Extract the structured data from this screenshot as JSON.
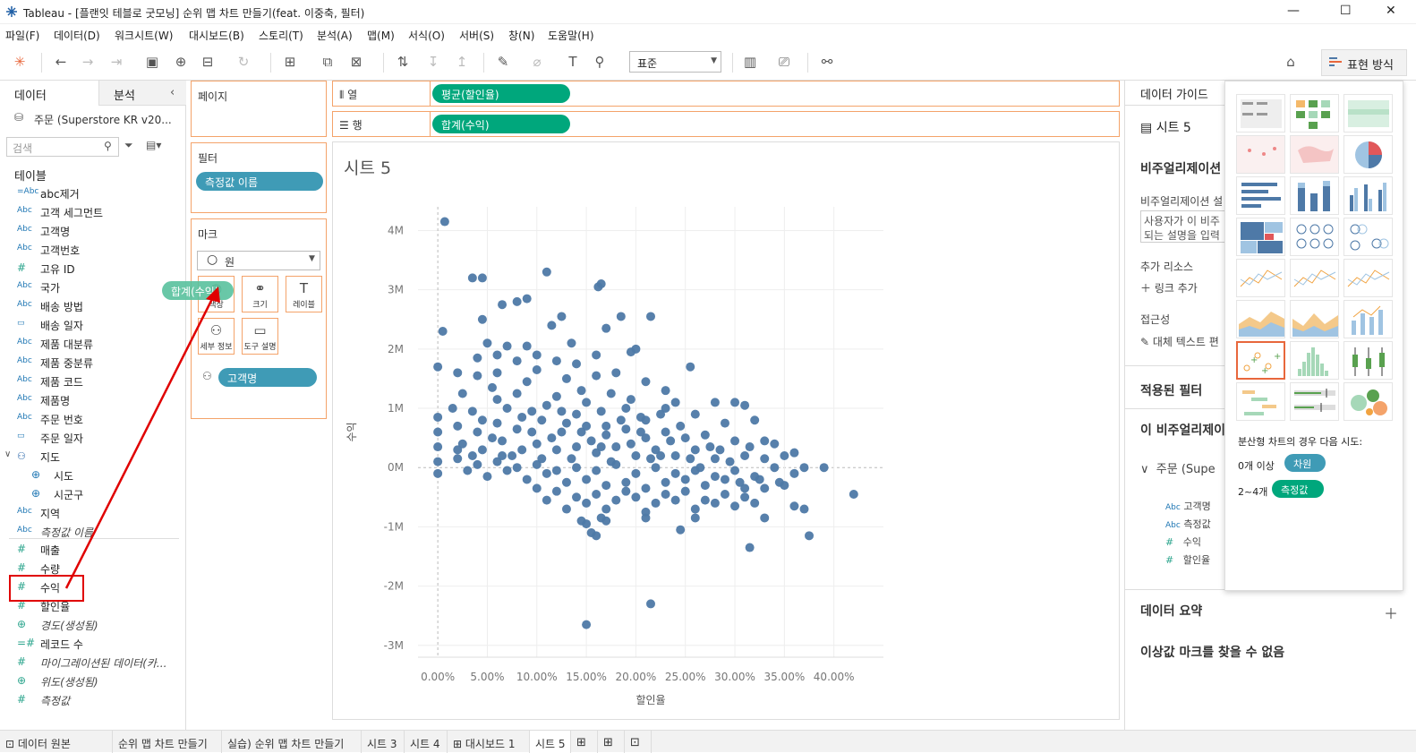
{
  "window": {
    "title": "Tableau - [플랜잇 테블로 굿모닝] 순위 맵 차트 만들기(feat. 이중축, 필터)",
    "min": "—",
    "max": "☐",
    "close": "✕"
  },
  "menu": [
    "파일(F)",
    "데이터(D)",
    "워크시트(W)",
    "대시보드(B)",
    "스토리(T)",
    "분석(A)",
    "맵(M)",
    "서식(O)",
    "서버(S)",
    "창(N)",
    "도움말(H)"
  ],
  "toolbar": {
    "fit_select": "표준",
    "show_me_label": "표현 방식"
  },
  "left_panel": {
    "tab_data": "데이터",
    "tab_analysis": "분석",
    "datasource": "주문 (Superstore KR v20...",
    "search_placeholder": "검색",
    "tables_header": "테이블",
    "fields": [
      {
        "type": "=Abc",
        "label": "abc제거",
        "italic": false
      },
      {
        "type": "Abc",
        "label": "고객 세그먼트",
        "italic": false
      },
      {
        "type": "Abc",
        "label": "고객명",
        "italic": false
      },
      {
        "type": "Abc",
        "label": "고객번호",
        "italic": false
      },
      {
        "type": "#",
        "label": "고유 ID",
        "italic": false
      },
      {
        "type": "Abc",
        "label": "국가",
        "italic": false
      },
      {
        "type": "Abc",
        "label": "배송 방법",
        "italic": false
      },
      {
        "type": "cal",
        "label": "배송 일자",
        "italic": false
      },
      {
        "type": "Abc",
        "label": "제품 대분류",
        "italic": false
      },
      {
        "type": "Abc",
        "label": "제품 중분류",
        "italic": false
      },
      {
        "type": "Abc",
        "label": "제품 코드",
        "italic": false
      },
      {
        "type": "Abc",
        "label": "제품명",
        "italic": false
      },
      {
        "type": "Abc",
        "label": "주문 번호",
        "italic": false
      },
      {
        "type": "cal",
        "label": "주문 일자",
        "italic": false
      },
      {
        "type": "hier",
        "label": "지도",
        "italic": false
      },
      {
        "type": "globe",
        "label": "시도",
        "italic": false,
        "indent": true
      },
      {
        "type": "globe",
        "label": "시군구",
        "italic": false,
        "indent": true
      },
      {
        "type": "Abc",
        "label": "지역",
        "italic": false
      },
      {
        "type": "Abc",
        "label": "측정값 이름",
        "italic": true
      }
    ],
    "measures": [
      {
        "type": "#",
        "label": "매출",
        "italic": false
      },
      {
        "type": "#",
        "label": "수량",
        "italic": false
      },
      {
        "type": "#",
        "label": "수익",
        "italic": false
      },
      {
        "type": "#",
        "label": "할인율",
        "italic": false
      },
      {
        "type": "globe",
        "label": "경도(생성됨)",
        "italic": true
      },
      {
        "type": "=#",
        "label": "레코드 수",
        "italic": false
      },
      {
        "type": "#",
        "label": "마이그레이션된 데이터(카...",
        "italic": true
      },
      {
        "type": "globe",
        "label": "위도(생성됨)",
        "italic": true
      },
      {
        "type": "#",
        "label": "측정값",
        "italic": true
      }
    ]
  },
  "mid_panel": {
    "pages": "페이지",
    "filters": "필터",
    "filter_pill": "측정값 이름",
    "marks": "마크",
    "mark_type": "원",
    "mark_buttons": [
      "색상",
      "크기",
      "레이블",
      "세부 정보",
      "도구 설명"
    ],
    "detail_pill": "고객명",
    "drag_pill": "합계(수익)"
  },
  "shelves": {
    "columns_label": "열",
    "columns_pill": "평균(할인율)",
    "rows_label": "행",
    "rows_pill": "합계(수익)"
  },
  "sheet_title": "시트 5",
  "chart_data": {
    "type": "scatter",
    "xlabel": "할인율",
    "ylabel": "수익",
    "xlim": [
      -0.02,
      0.45
    ],
    "ylim": [
      -3.2,
      4.4
    ],
    "x_ticks": [
      "0.00%",
      "5.00%",
      "10.00%",
      "15.00%",
      "20.00%",
      "25.00%",
      "30.00%",
      "35.00%",
      "40.00%"
    ],
    "y_ticks": [
      "4M",
      "3M",
      "2M",
      "1M",
      "0M",
      "-1M",
      "-2M",
      "-3M"
    ],
    "color": "#4e79a7",
    "points_note": "approx 800 customers",
    "points": [
      [
        0.007,
        4.15
      ],
      [
        0.035,
        3.2
      ],
      [
        0.045,
        3.2
      ],
      [
        0.11,
        3.3
      ],
      [
        0.165,
        3.1
      ],
      [
        0.162,
        3.05
      ],
      [
        0.09,
        2.85
      ],
      [
        0.08,
        2.8
      ],
      [
        0.065,
        2.75
      ],
      [
        0.125,
        2.55
      ],
      [
        0.215,
        2.55
      ],
      [
        0.185,
        2.55
      ],
      [
        0.17,
        2.35
      ],
      [
        0.115,
        2.4
      ],
      [
        0.045,
        2.5
      ],
      [
        0.005,
        2.3
      ],
      [
        0.05,
        2.1
      ],
      [
        0.07,
        2.05
      ],
      [
        0.09,
        2.05
      ],
      [
        0.135,
        2.1
      ],
      [
        0.2,
        2.0
      ],
      [
        0.195,
        1.95
      ],
      [
        0.255,
        1.7
      ],
      [
        0.0,
        1.7
      ],
      [
        0.02,
        1.6
      ],
      [
        0.04,
        1.55
      ],
      [
        0.06,
        1.6
      ],
      [
        0.1,
        1.65
      ],
      [
        0.13,
        1.5
      ],
      [
        0.16,
        1.55
      ],
      [
        0.21,
        1.45
      ],
      [
        0.23,
        1.3
      ],
      [
        0.025,
        1.25
      ],
      [
        0.055,
        1.35
      ],
      [
        0.08,
        1.25
      ],
      [
        0.12,
        1.2
      ],
      [
        0.145,
        1.3
      ],
      [
        0.175,
        1.25
      ],
      [
        0.195,
        1.15
      ],
      [
        0.24,
        1.1
      ],
      [
        0.28,
        1.1
      ],
      [
        0.3,
        1.1
      ],
      [
        0.31,
        1.05
      ],
      [
        0.0,
        0.85
      ],
      [
        0.015,
        1.0
      ],
      [
        0.035,
        0.95
      ],
      [
        0.07,
        1.0
      ],
      [
        0.095,
        0.95
      ],
      [
        0.14,
        0.9
      ],
      [
        0.165,
        0.95
      ],
      [
        0.205,
        0.85
      ],
      [
        0.225,
        0.9
      ],
      [
        0.26,
        0.9
      ],
      [
        0.29,
        0.75
      ],
      [
        0.32,
        0.8
      ],
      [
        0.0,
        0.6
      ],
      [
        0.02,
        0.7
      ],
      [
        0.04,
        0.6
      ],
      [
        0.06,
        0.75
      ],
      [
        0.08,
        0.65
      ],
      [
        0.105,
        0.8
      ],
      [
        0.125,
        0.6
      ],
      [
        0.15,
        0.7
      ],
      [
        0.17,
        0.55
      ],
      [
        0.19,
        0.65
      ],
      [
        0.21,
        0.5
      ],
      [
        0.23,
        0.6
      ],
      [
        0.25,
        0.5
      ],
      [
        0.27,
        0.55
      ],
      [
        0.3,
        0.45
      ],
      [
        0.33,
        0.45
      ],
      [
        0.34,
        0.4
      ],
      [
        0.0,
        0.35
      ],
      [
        0.025,
        0.4
      ],
      [
        0.045,
        0.3
      ],
      [
        0.065,
        0.45
      ],
      [
        0.085,
        0.3
      ],
      [
        0.1,
        0.4
      ],
      [
        0.12,
        0.3
      ],
      [
        0.14,
        0.35
      ],
      [
        0.16,
        0.25
      ],
      [
        0.18,
        0.35
      ],
      [
        0.2,
        0.2
      ],
      [
        0.22,
        0.3
      ],
      [
        0.24,
        0.2
      ],
      [
        0.26,
        0.3
      ],
      [
        0.28,
        0.15
      ],
      [
        0.31,
        0.2
      ],
      [
        0.33,
        0.15
      ],
      [
        0.35,
        0.2
      ],
      [
        0.36,
        0.25
      ],
      [
        0.0,
        0.1
      ],
      [
        0.02,
        0.15
      ],
      [
        0.04,
        0.05
      ],
      [
        0.06,
        0.1
      ],
      [
        0.08,
        0.0
      ],
      [
        0.1,
        0.05
      ],
      [
        0.12,
        -0.05
      ],
      [
        0.14,
        0.0
      ],
      [
        0.16,
        -0.05
      ],
      [
        0.18,
        0.05
      ],
      [
        0.2,
        -0.1
      ],
      [
        0.22,
        0.0
      ],
      [
        0.24,
        -0.1
      ],
      [
        0.26,
        -0.05
      ],
      [
        0.28,
        -0.15
      ],
      [
        0.3,
        -0.05
      ],
      [
        0.32,
        -0.15
      ],
      [
        0.34,
        0.0
      ],
      [
        0.36,
        -0.1
      ],
      [
        0.37,
        0.0
      ],
      [
        0.39,
        0.0
      ],
      [
        0.42,
        -0.45
      ],
      [
        0.0,
        -0.1
      ],
      [
        0.03,
        -0.05
      ],
      [
        0.05,
        -0.15
      ],
      [
        0.07,
        -0.05
      ],
      [
        0.09,
        -0.2
      ],
      [
        0.11,
        -0.1
      ],
      [
        0.13,
        -0.25
      ],
      [
        0.15,
        -0.2
      ],
      [
        0.17,
        -0.3
      ],
      [
        0.19,
        -0.25
      ],
      [
        0.21,
        -0.35
      ],
      [
        0.23,
        -0.25
      ],
      [
        0.25,
        -0.4
      ],
      [
        0.27,
        -0.3
      ],
      [
        0.29,
        -0.45
      ],
      [
        0.31,
        -0.35
      ],
      [
        0.35,
        -0.3
      ],
      [
        0.36,
        -0.65
      ],
      [
        0.37,
        -0.7
      ],
      [
        0.1,
        -0.35
      ],
      [
        0.12,
        -0.4
      ],
      [
        0.14,
        -0.5
      ],
      [
        0.16,
        -0.45
      ],
      [
        0.18,
        -0.55
      ],
      [
        0.2,
        -0.5
      ],
      [
        0.22,
        -0.6
      ],
      [
        0.24,
        -0.55
      ],
      [
        0.26,
        -0.7
      ],
      [
        0.28,
        -0.6
      ],
      [
        0.3,
        -0.65
      ],
      [
        0.32,
        -0.6
      ],
      [
        0.33,
        -0.85
      ],
      [
        0.145,
        -0.9
      ],
      [
        0.15,
        -0.95
      ],
      [
        0.165,
        -0.85
      ],
      [
        0.17,
        -0.9
      ],
      [
        0.21,
        -0.85
      ],
      [
        0.245,
        -1.05
      ],
      [
        0.26,
        -0.85
      ],
      [
        0.155,
        -1.1
      ],
      [
        0.16,
        -1.15
      ],
      [
        0.375,
        -1.15
      ],
      [
        0.315,
        -1.35
      ],
      [
        0.215,
        -2.3
      ],
      [
        0.15,
        -2.65
      ],
      [
        0.02,
        0.3
      ],
      [
        0.035,
        0.2
      ],
      [
        0.055,
        0.5
      ],
      [
        0.075,
        0.2
      ],
      [
        0.095,
        0.6
      ],
      [
        0.115,
        0.5
      ],
      [
        0.135,
        0.15
      ],
      [
        0.155,
        0.45
      ],
      [
        0.175,
        0.1
      ],
      [
        0.195,
        0.4
      ],
      [
        0.215,
        0.15
      ],
      [
        0.235,
        0.45
      ],
      [
        0.255,
        0.15
      ],
      [
        0.275,
        0.35
      ],
      [
        0.295,
        0.1
      ],
      [
        0.315,
        0.35
      ],
      [
        0.045,
        0.8
      ],
      [
        0.065,
        0.2
      ],
      [
        0.085,
        0.85
      ],
      [
        0.105,
        0.15
      ],
      [
        0.125,
        0.95
      ],
      [
        0.145,
        0.6
      ],
      [
        0.165,
        0.35
      ],
      [
        0.185,
        0.8
      ],
      [
        0.205,
        0.6
      ],
      [
        0.225,
        0.2
      ],
      [
        0.245,
        0.7
      ],
      [
        0.265,
        0.0
      ],
      [
        0.285,
        0.3
      ],
      [
        0.305,
        -0.25
      ],
      [
        0.325,
        -0.2
      ],
      [
        0.345,
        -0.25
      ],
      [
        0.06,
        1.15
      ],
      [
        0.09,
        1.45
      ],
      [
        0.11,
        1.05
      ],
      [
        0.13,
        0.75
      ],
      [
        0.15,
        1.1
      ],
      [
        0.17,
        0.7
      ],
      [
        0.19,
        1.0
      ],
      [
        0.21,
        0.8
      ],
      [
        0.23,
        1.0
      ],
      [
        0.11,
        -0.55
      ],
      [
        0.13,
        -0.7
      ],
      [
        0.15,
        -0.6
      ],
      [
        0.17,
        -0.7
      ],
      [
        0.19,
        -0.4
      ],
      [
        0.21,
        -0.75
      ],
      [
        0.23,
        -0.45
      ],
      [
        0.25,
        -0.2
      ],
      [
        0.27,
        -0.55
      ],
      [
        0.29,
        -0.2
      ],
      [
        0.31,
        -0.5
      ],
      [
        0.33,
        -0.35
      ],
      [
        0.12,
        1.8
      ],
      [
        0.14,
        1.75
      ],
      [
        0.16,
        1.9
      ],
      [
        0.18,
        1.6
      ],
      [
        0.08,
        1.8
      ],
      [
        0.04,
        1.85
      ],
      [
        0.06,
        1.9
      ],
      [
        0.1,
        1.9
      ]
    ]
  },
  "right_panel": {
    "guide_header": "데이터 가이드",
    "sheet": "시트 5",
    "viz_header": "비주얼리제이션",
    "viz_desc_label": "비주얼리제이션 설",
    "desc_line1": "사용자가 이 비주",
    "desc_line2": "되는 설명을 입력",
    "resources": "추가 리소스",
    "add_link": "링크 추가",
    "accessibility": "접근성",
    "alt_text": "대체 텍스트 편",
    "applied_filters": "적용된 필터",
    "this_viz": "이 비주얼리제이",
    "source_node": "주문 (Supe",
    "used_fields": [
      "고객명",
      "측정값",
      "수익",
      "할인율"
    ],
    "data_summary": "데이터 요약",
    "outliers": "이상값 마크를 찾을 수 없음"
  },
  "show_me": {
    "hint": "분산형 차트의 경우 다음 시도:",
    "req1_label": "0개 이상",
    "req1_pill": "차원",
    "req2_label": "2~4개",
    "req2_pill": "측정값"
  },
  "sheet_tabs": [
    "데이터 원본",
    "순위 맵 차트 만들기",
    "실습) 순위 맵 차트 만들기",
    "시트 3",
    "시트 4",
    "대시보드 1",
    "시트 5"
  ],
  "colors": {
    "accent": "#e8673c",
    "shelf_border": "#f4a36a",
    "pill_green": "#00a77c",
    "pill_blue": "#3f9bb6",
    "mark": "#4e79a7",
    "annotation": "#e00000"
  }
}
